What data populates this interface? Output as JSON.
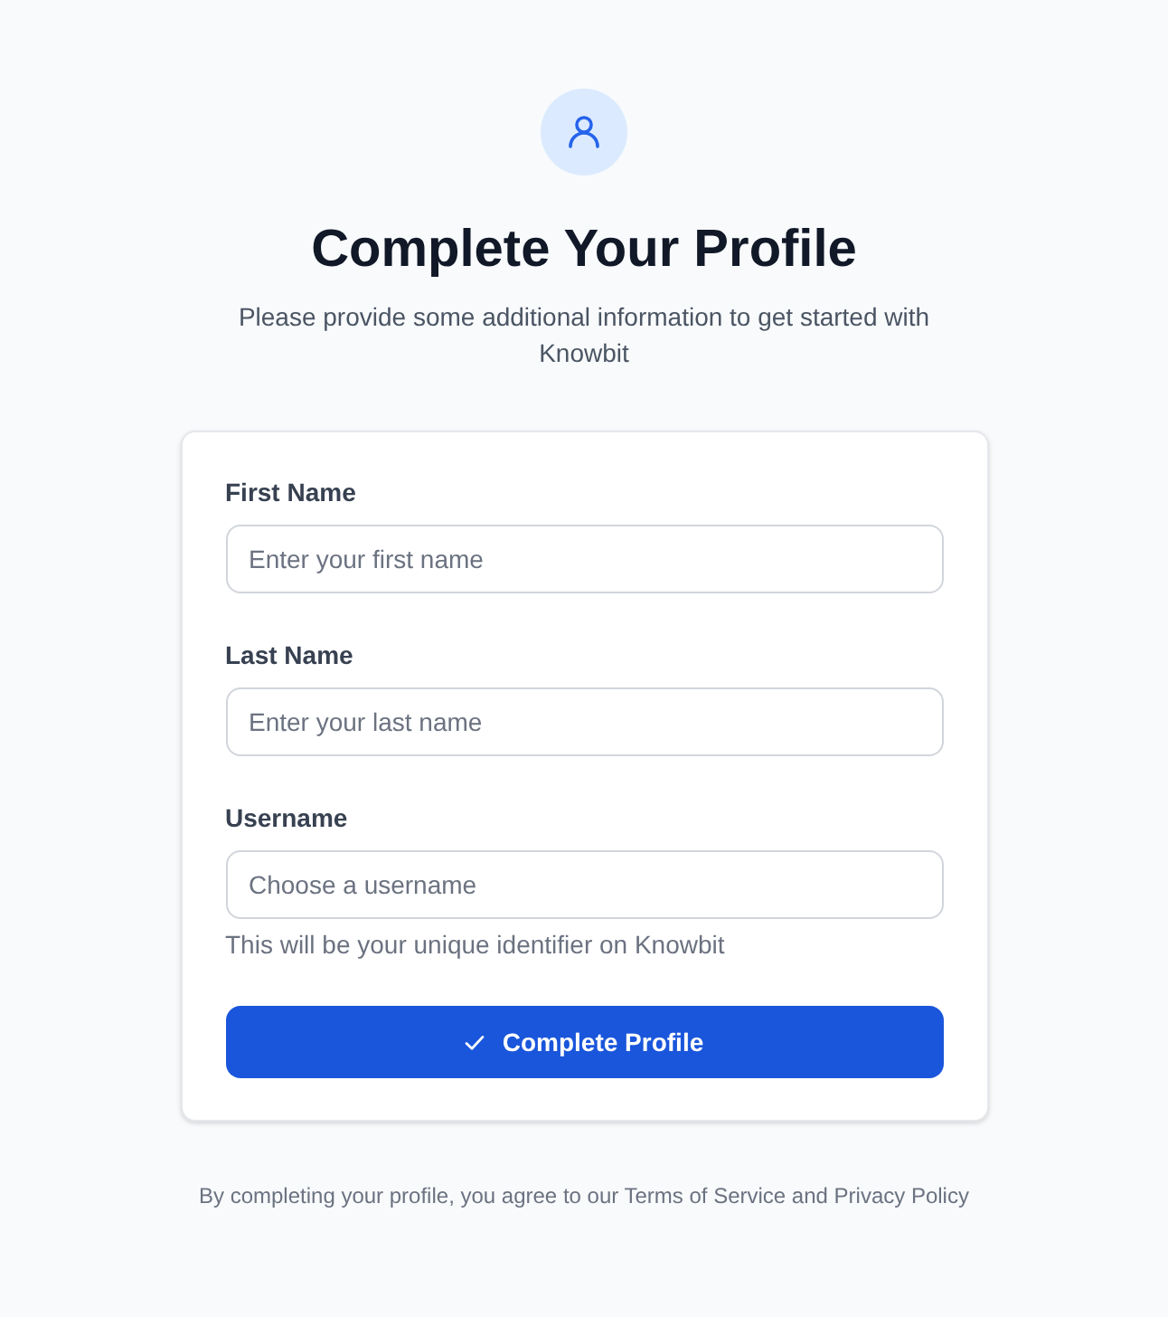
{
  "header": {
    "title": "Complete Your Profile",
    "subtitle": "Please provide some additional information to get started with Knowbit"
  },
  "form": {
    "fields": [
      {
        "label": "First Name",
        "placeholder": "Enter your first name"
      },
      {
        "label": "Last Name",
        "placeholder": "Enter your last name"
      },
      {
        "label": "Username",
        "placeholder": "Choose a username",
        "hint": "This will be your unique identifier on Knowbit"
      }
    ],
    "submit_button": {
      "label": "Complete Profile"
    }
  },
  "footer": {
    "text": "By completing your profile, you agree to our Terms of Service and Privacy Policy"
  }
}
